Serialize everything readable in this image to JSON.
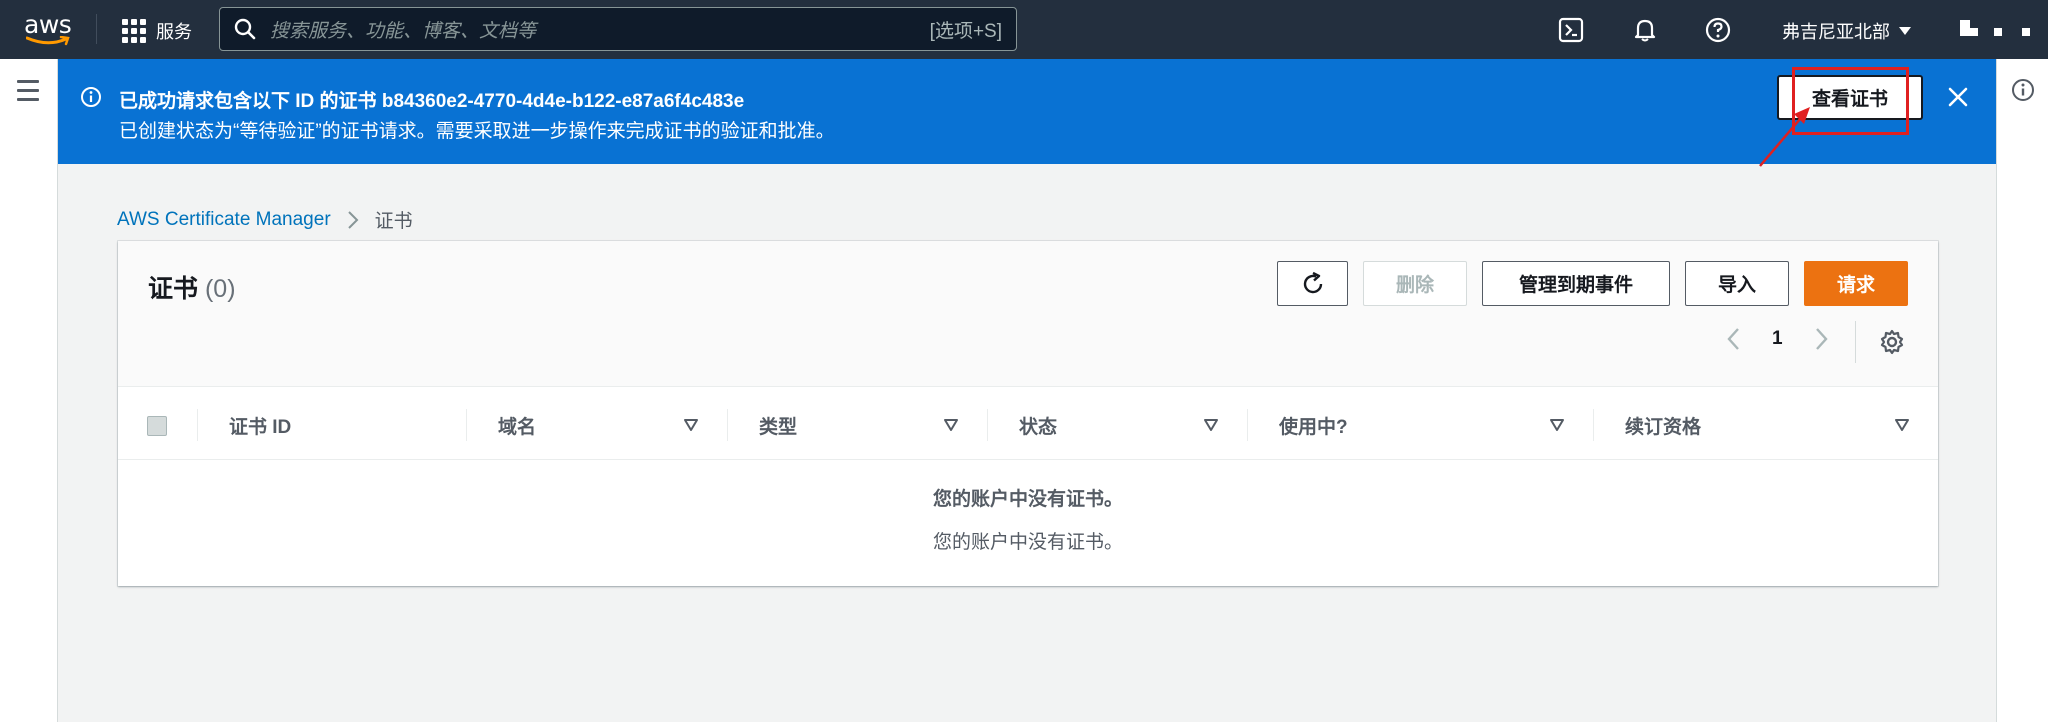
{
  "topnav": {
    "logo_text": "aws",
    "services_label": "服务",
    "search_placeholder": "搜索服务、功能、博客、文档等",
    "search_shortcut": "[选项+S]",
    "region_label": "弗吉尼亚北部"
  },
  "flash": {
    "title": "已成功请求包含以下 ID 的证书 b84360e2-4770-4d4e-b122-e87a6f4c483e",
    "description": "已创建状态为“等待验证”的证书请求。需要采取进一步操作来完成证书的验证和批准。",
    "view_button": "查看证书"
  },
  "breadcrumb": {
    "root": "AWS Certificate Manager",
    "current": "证书"
  },
  "table": {
    "title": "证书",
    "count": "(0)",
    "buttons": {
      "delete": "删除",
      "manage_expiry": "管理到期事件",
      "import": "导入",
      "request": "请求"
    },
    "page_number": "1",
    "columns": [
      "证书 ID",
      "域名",
      "类型",
      "状态",
      "使用中?",
      "续订资格"
    ],
    "empty_title": "您的账户中没有证书。",
    "empty_subtitle": "您的账户中没有证书。"
  },
  "colors": {
    "nav_bg": "#232f3e",
    "flash_bg": "#0972d3",
    "primary": "#ec7211",
    "link": "#0073bb",
    "annotation": "#e02020"
  }
}
